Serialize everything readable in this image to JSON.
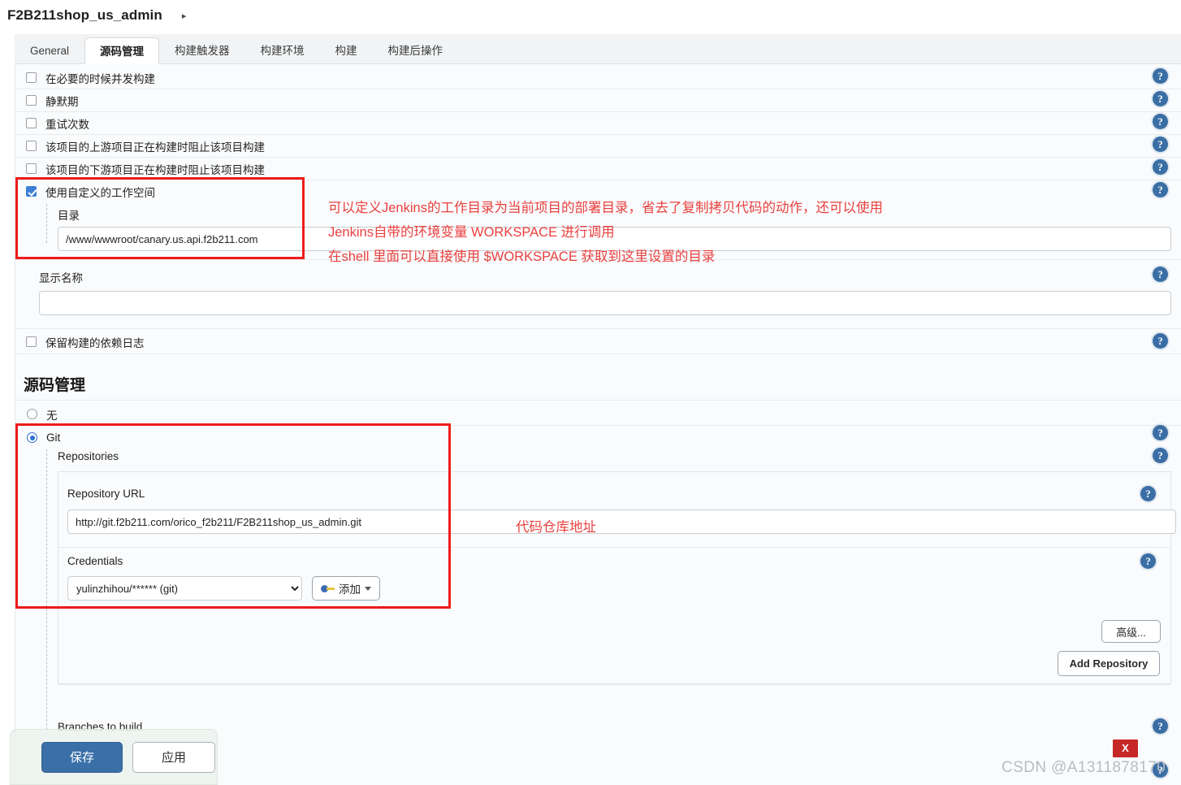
{
  "header": {
    "job_name": "F2B211shop_us_admin",
    "caret_icon": "chevron-right-icon"
  },
  "tabs": [
    {
      "label": "General",
      "active": false
    },
    {
      "label": "源码管理",
      "active": true
    },
    {
      "label": "构建触发器",
      "active": false
    },
    {
      "label": "构建环境",
      "active": false
    },
    {
      "label": "构建",
      "active": false
    },
    {
      "label": "构建后操作",
      "active": false
    }
  ],
  "general_options": [
    {
      "label": "在必要的时候并发构建",
      "checked": false
    },
    {
      "label": "静默期",
      "checked": false
    },
    {
      "label": "重试次数",
      "checked": false
    },
    {
      "label": "该项目的上游项目正在构建时阻止该项目构建",
      "checked": false
    },
    {
      "label": "该项目的下游项目正在构建时阻止该项目构建",
      "checked": false
    },
    {
      "label": "使用自定义的工作空间",
      "checked": true
    }
  ],
  "workspace": {
    "directory_label": "目录",
    "directory_value": "/www/wwwroot/canary.us.api.f2b211.com"
  },
  "display_name": {
    "label": "显示名称",
    "value": "",
    "placeholder": ""
  },
  "keep_dependencies": {
    "label": "保留构建的依赖日志",
    "checked": false
  },
  "scm": {
    "section_title": "源码管理",
    "options": [
      {
        "label": "无",
        "selected": false
      },
      {
        "label": "Git",
        "selected": true
      }
    ],
    "repositories_label": "Repositories",
    "repository_url_label": "Repository URL",
    "repository_url_value": "http://git.f2b211.com/orico_f2b211/F2B211shop_us_admin.git",
    "credentials_label": "Credentials",
    "credentials_value": "yulinzhihou/****** (git)",
    "add_button_label": "添加",
    "add_button_icon": "key-icon",
    "add_button_caret": "chevron-down-icon",
    "advanced_button_label": "高级...",
    "add_repository_button_label": "Add Repository",
    "branches_label": "Branches to build"
  },
  "annotations": {
    "workspace_note_line1": "可以定义Jenkins的工作目录为当前项目的部署目录，省去了复制拷贝代码的动作，还可以使用",
    "workspace_note_line2": "Jenkins自带的环境变量 WORKSPACE 进行调用",
    "workspace_note_line3": "在shell 里面可以直接使用 $WORKSPACE 获取到这里设置的目录",
    "repo_note": "代码仓库地址",
    "color": "#e8413f"
  },
  "footer": {
    "save_label": "保存",
    "apply_label": "应用",
    "close_label": "X",
    "watermark": "CSDN @A1311878170"
  },
  "help_icon": {
    "glyph": "?",
    "name": "help-icon",
    "color": "#3a6ea5"
  }
}
